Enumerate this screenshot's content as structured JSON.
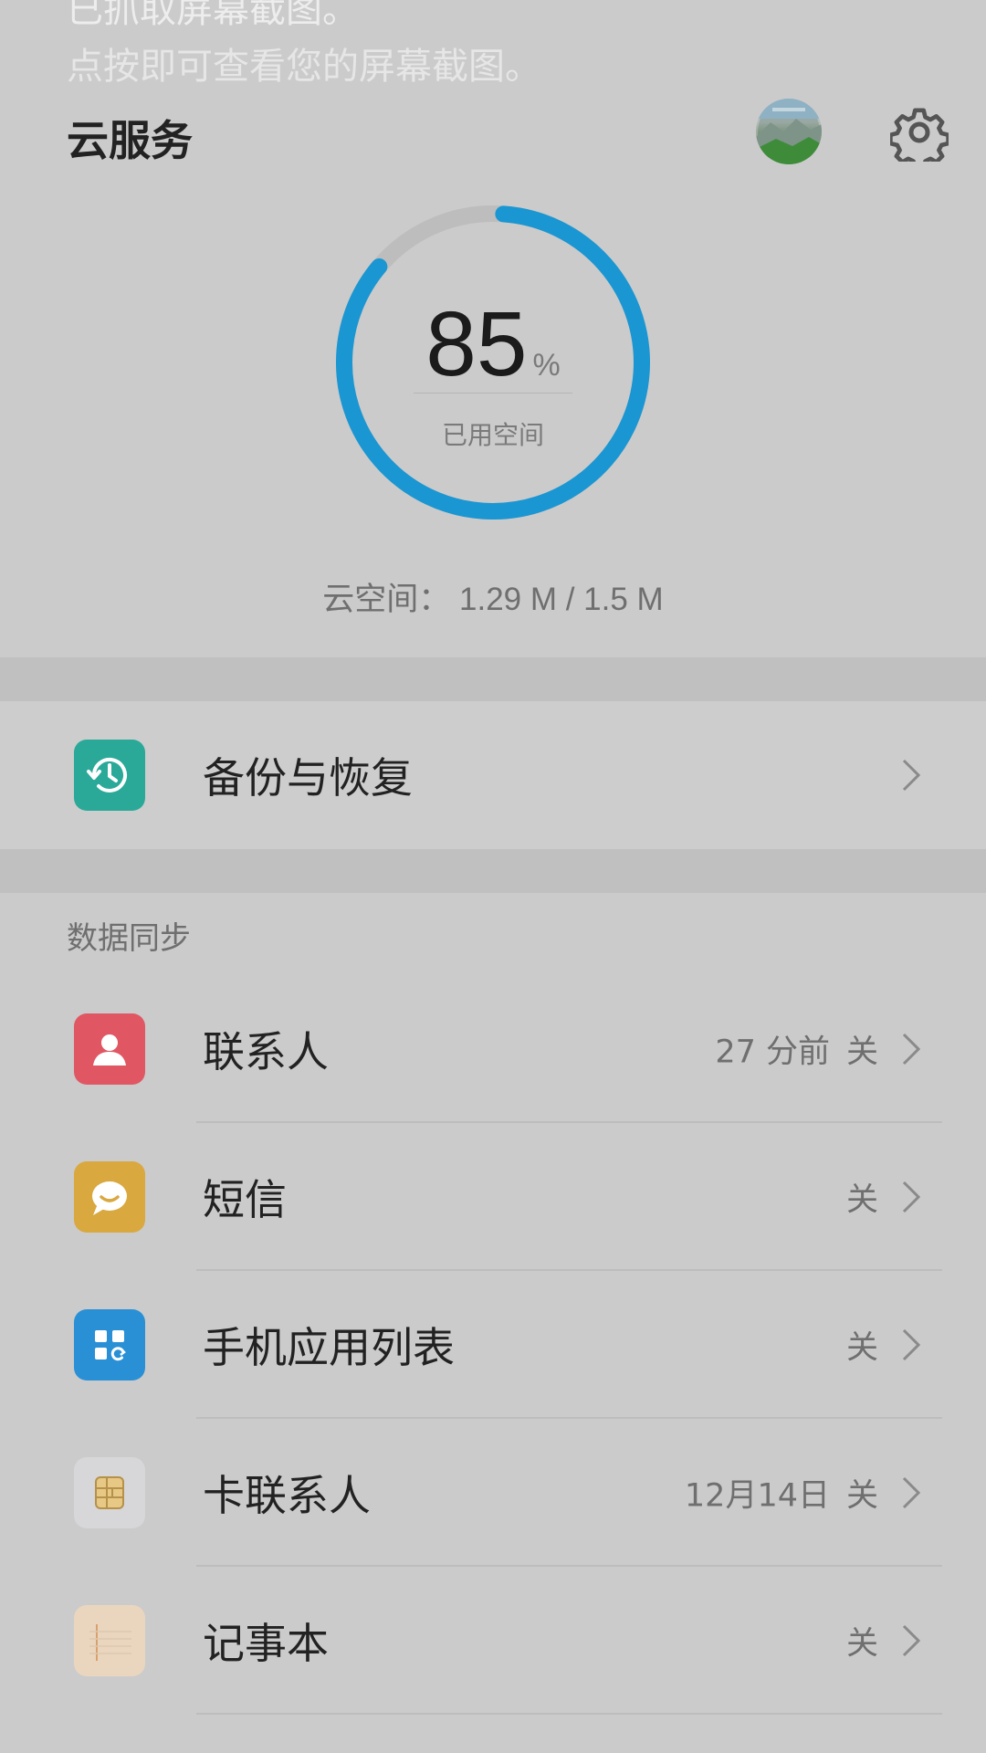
{
  "notification": {
    "title": "已抓取屏幕截图。",
    "subtitle": "点按即可查看您的屏幕截图。"
  },
  "header": {
    "title": "云服务",
    "avatar_icon": "avatar-landscape",
    "settings_icon": "gear-icon"
  },
  "storage": {
    "percent": 85,
    "percent_text": "85",
    "percent_sign": "%",
    "label": "已用空间",
    "summary": "云空间： 1.29 M / 1.5 M",
    "accent": "#1a96d2",
    "track": "#bdbdbd"
  },
  "backup": {
    "label": "备份与恢复",
    "icon": "clock-restore-icon",
    "icon_color": "#2aa999"
  },
  "sync": {
    "section_title": "数据同步",
    "items": [
      {
        "label": "联系人",
        "time": "27 分前",
        "status": "关",
        "icon": "contact-icon",
        "icon_color": "#e05763"
      },
      {
        "label": "短信",
        "time": "",
        "status": "关",
        "icon": "message-icon",
        "icon_color": "#d9a83f"
      },
      {
        "label": "手机应用列表",
        "time": "",
        "status": "关",
        "icon": "app-list-icon",
        "icon_color": "#2a90d6"
      },
      {
        "label": "卡联系人",
        "time": "12月14日",
        "status": "关",
        "icon": "sim-card-icon",
        "icon_color": "#d7d7d9"
      },
      {
        "label": "记事本",
        "time": "",
        "status": "关",
        "icon": "notepad-icon",
        "icon_color": "#ead6bf"
      }
    ]
  }
}
